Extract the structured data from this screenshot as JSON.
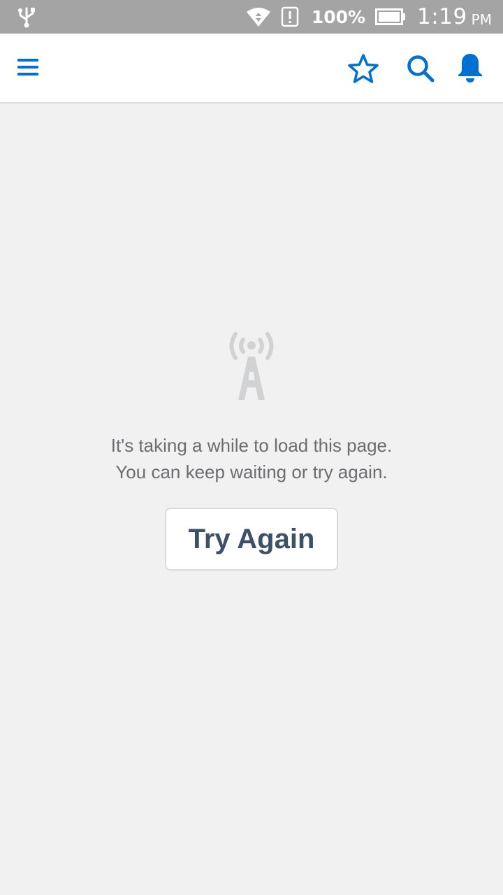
{
  "status_bar": {
    "battery_percent": "100%",
    "time": "1:19",
    "ampm": "PM",
    "icons": [
      "usb-icon",
      "wifi-icon",
      "alert-icon",
      "battery-icon"
    ]
  },
  "header": {
    "icons": [
      "menu-icon",
      "star-icon",
      "search-icon",
      "bell-icon"
    ],
    "accent_color": "#0070d2"
  },
  "error": {
    "icon": "signal-tower-icon",
    "line1": "It's taking a while to load this page.",
    "line2": "You can keep waiting or try again.",
    "retry_label": "Try Again"
  }
}
